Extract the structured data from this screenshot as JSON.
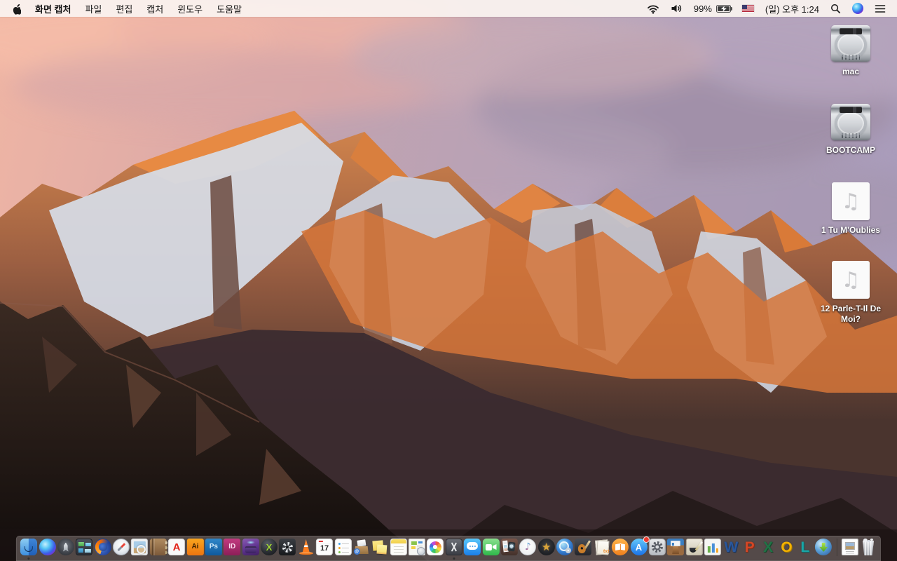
{
  "menubar": {
    "app_name": "화면 캡처",
    "menus": [
      "파일",
      "편집",
      "캡처",
      "윈도우",
      "도움말"
    ],
    "status": {
      "battery_percent": "99%",
      "clock": "(일) 오후 1:24"
    }
  },
  "desktop": {
    "audio_glyph": "♫",
    "icons": [
      {
        "name": "mac",
        "type": "drive",
        "label": "mac"
      },
      {
        "name": "bootcamp",
        "type": "drive",
        "label": "BOOTCAMP"
      },
      {
        "name": "tu-m-oublies",
        "type": "audio",
        "label": "1 Tu M'Oublies"
      },
      {
        "name": "parle-t-il-de-moi",
        "type": "audio",
        "label": "12 Parle-T-Il De Moi?"
      }
    ]
  },
  "dock": {
    "items": [
      {
        "name": "finder",
        "kind": "finder",
        "running": true
      },
      {
        "name": "siri",
        "kind": "siri"
      },
      {
        "name": "launchpad",
        "kind": "launchpad"
      },
      {
        "name": "mission-control",
        "kind": "missionctl"
      },
      {
        "name": "firefox",
        "kind": "firefox"
      },
      {
        "name": "safari",
        "kind": "safari"
      },
      {
        "name": "preview",
        "kind": "preview"
      },
      {
        "name": "contacts",
        "kind": "contacts"
      },
      {
        "name": "acrobat-reader",
        "kind": "acrobat",
        "glyph": "A"
      },
      {
        "name": "illustrator",
        "kind": "illustrator",
        "glyph": "Ai"
      },
      {
        "name": "photoshop",
        "kind": "photoshop",
        "glyph": "Ps"
      },
      {
        "name": "indesign",
        "kind": "indesign",
        "glyph": "ID"
      },
      {
        "name": "toast",
        "kind": "toast"
      },
      {
        "name": "xee",
        "kind": "xee",
        "glyph": "X"
      },
      {
        "name": "fan-utility",
        "kind": "fanapp"
      },
      {
        "name": "vlc",
        "kind": "vlc"
      },
      {
        "name": "calendar",
        "kind": "calendar",
        "glyph": "17"
      },
      {
        "name": "reminders",
        "kind": "reminders"
      },
      {
        "name": "unarchiver",
        "kind": "unarchiver",
        "glyph": "@"
      },
      {
        "name": "stickies",
        "kind": "stickies"
      },
      {
        "name": "notes",
        "kind": "notes"
      },
      {
        "name": "web-template-app",
        "kind": "webdoc"
      },
      {
        "name": "photos",
        "kind": "photos"
      },
      {
        "name": "grab-screen-capture",
        "kind": "grab",
        "running": true
      },
      {
        "name": "messages",
        "kind": "messages"
      },
      {
        "name": "facetime",
        "kind": "facetime"
      },
      {
        "name": "photo-booth",
        "kind": "photobooth"
      },
      {
        "name": "itunes",
        "kind": "itunes",
        "glyph": "♪"
      },
      {
        "name": "imovie",
        "kind": "imovie",
        "glyph": "★"
      },
      {
        "name": "dvd-player",
        "kind": "dvdplayer"
      },
      {
        "name": "garageband",
        "kind": "garageband"
      },
      {
        "name": "text-stack",
        "kind": "txtstack",
        "glyph": "txt"
      },
      {
        "name": "ibooks",
        "kind": "ibooks"
      },
      {
        "name": "app-store",
        "kind": "appstore",
        "glyph": "A",
        "badge": true
      },
      {
        "name": "system-preferences",
        "kind": "sysprefs"
      },
      {
        "name": "keynote",
        "kind": "keynote"
      },
      {
        "name": "pages",
        "kind": "pages"
      },
      {
        "name": "numbers",
        "kind": "numbers"
      },
      {
        "name": "word",
        "kind": "word",
        "glyph": "W"
      },
      {
        "name": "powerpoint",
        "kind": "ppt",
        "glyph": "P"
      },
      {
        "name": "excel",
        "kind": "excel",
        "glyph": "X"
      },
      {
        "name": "outlook",
        "kind": "outlook",
        "glyph": "O"
      },
      {
        "name": "lync",
        "kind": "lync",
        "glyph": "L"
      },
      {
        "name": "downloader",
        "kind": "downloader"
      }
    ],
    "right_items": [
      {
        "name": "document",
        "kind": "docfile"
      },
      {
        "name": "trash",
        "kind": "trash",
        "full": true
      }
    ]
  },
  "colors": {
    "menubar_bg": "rgba(250,243,240,0.93)",
    "dock_bg": "rgba(145,133,131,0.48)",
    "badge": "#ec3b2f"
  }
}
